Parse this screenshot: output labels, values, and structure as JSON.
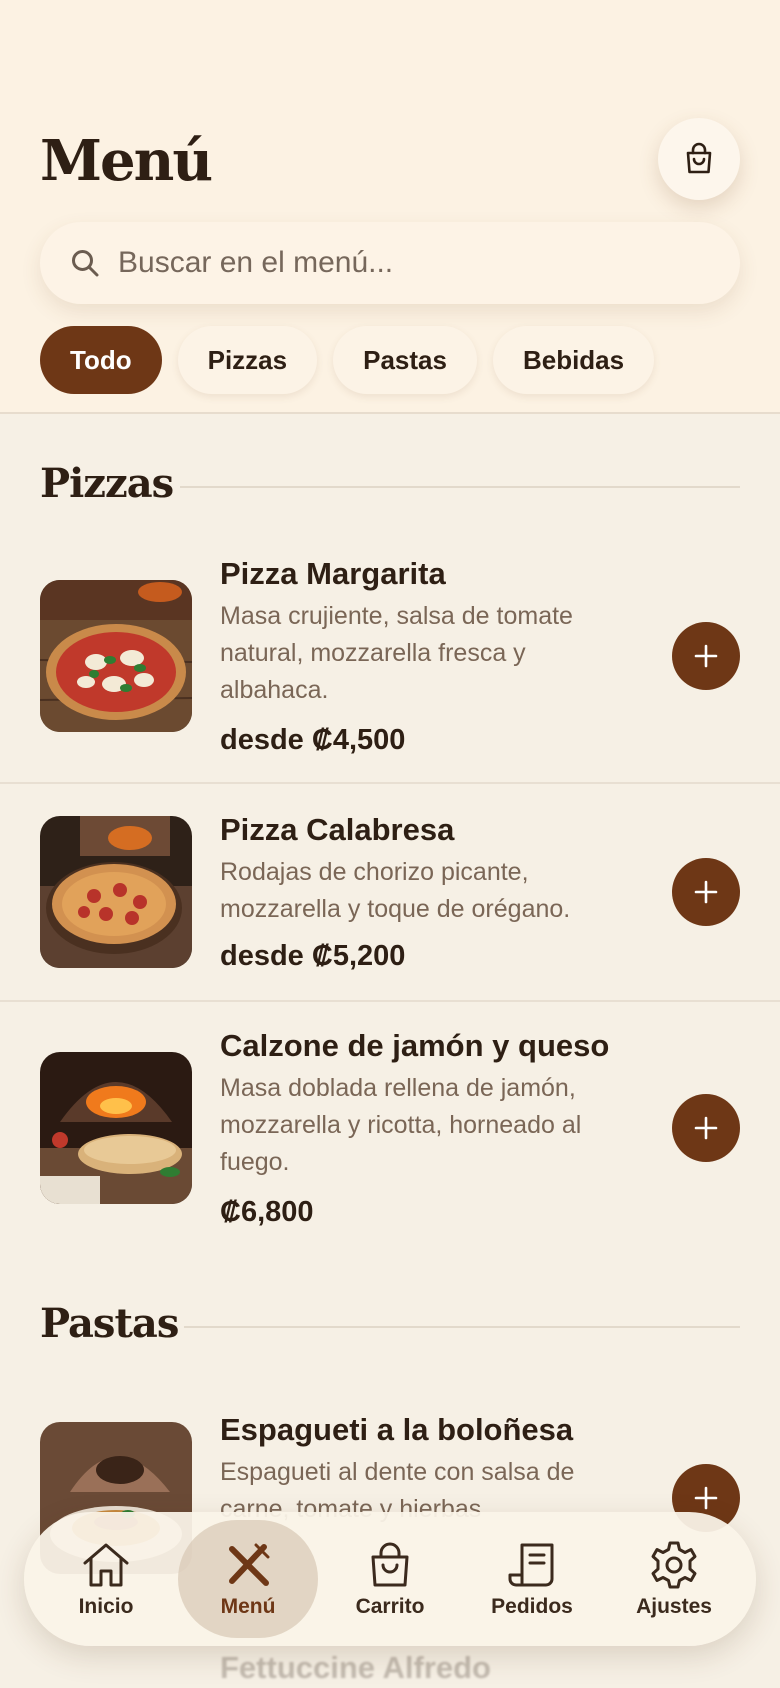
{
  "header": {
    "title": "Menú",
    "search_placeholder": "Buscar en el menú...",
    "chips": [
      "Todo",
      "Pizzas",
      "Pastas",
      "Bebidas"
    ],
    "active_chip": "Todo"
  },
  "sections": [
    {
      "title": "Pizzas",
      "items": [
        {
          "name": "Pizza Margarita",
          "description": "Masa crujiente, salsa de tomate natural, mozzarella fresca y albahaca.",
          "price": "desde ₡4,500"
        },
        {
          "name": "Pizza Calabresa",
          "description": "Rodajas de chorizo picante, mozzarella y toque de orégano.",
          "price": "desde ₡5,200"
        },
        {
          "name": "Calzone de jamón y queso",
          "description": "Masa doblada rellena de jamón, mozzarella y ricotta, horneado al fuego.",
          "price": "₡6,800"
        }
      ]
    },
    {
      "title": "Pastas",
      "items": [
        {
          "name": "Espagueti a la boloñesa",
          "description": "Espagueti al dente con salsa de carne, tomate y hierbas",
          "price": ""
        },
        {
          "name": "Fettuccine Alfredo",
          "description": "",
          "price": ""
        }
      ]
    }
  ],
  "bottom_nav": [
    {
      "label": "Inicio",
      "icon": "home-icon"
    },
    {
      "label": "Menú",
      "icon": "utensils-icon"
    },
    {
      "label": "Carrito",
      "icon": "bag-icon"
    },
    {
      "label": "Pedidos",
      "icon": "receipt-icon"
    },
    {
      "label": "Ajustes",
      "icon": "gear-icon"
    }
  ],
  "active_nav": "Menú",
  "colors": {
    "accent": "#6e3716",
    "header_bg": "#fcf2e3",
    "page_bg": "#f6f0e5",
    "text": "#2e1f14",
    "muted": "#7a6656"
  }
}
